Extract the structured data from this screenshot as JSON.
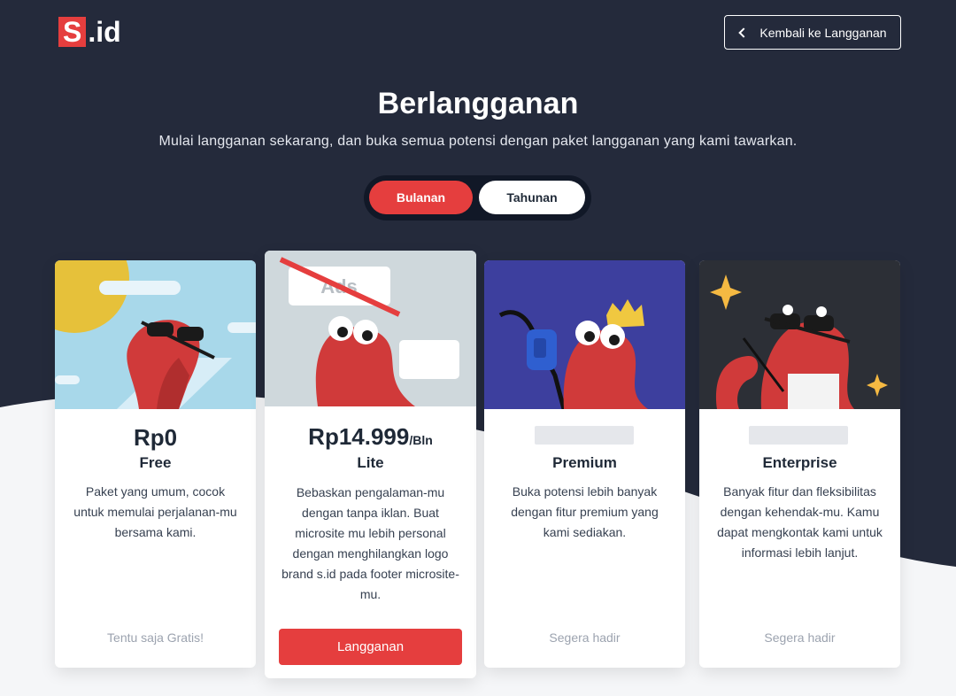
{
  "header": {
    "logo_mark": "S",
    "logo_rest": ".id",
    "back_label": "Kembali ke Langganan"
  },
  "hero": {
    "title": "Berlangganan",
    "subtitle": "Mulai langganan sekarang, dan buka semua potensi dengan paket langganan yang kami tawarkan."
  },
  "billing_toggle": {
    "monthly_label": "Bulanan",
    "yearly_label": "Tahunan",
    "selected": "Bulanan"
  },
  "plans": [
    {
      "price": "Rp0",
      "price_period": "",
      "name": "Free",
      "description": "Paket yang umum, cocok untuk memulai perjalanan-mu bersama kami.",
      "footer": "Tentu saja Gratis!"
    },
    {
      "price": "Rp14.999",
      "price_period": "/Bln",
      "name": "Lite",
      "description": "Bebaskan pengalaman-mu dengan tanpa iklan. Buat microsite mu lebih personal dengan menghilangkan logo brand s.id pada footer microsite-mu.",
      "button_label": "Langganan",
      "illustration_text": "Ads"
    },
    {
      "price": "",
      "name": "Premium",
      "description": "Buka potensi lebih banyak dengan fitur premium yang kami sediakan.",
      "footer": "Segera hadir"
    },
    {
      "price": "",
      "name": "Enterprise",
      "description": "Banyak fitur dan fleksibilitas dengan kehendak-mu. Kamu dapat mengkontak kami untuk informasi lebih lanjut.",
      "footer": "Segera hadir"
    }
  ],
  "colors": {
    "header_bg": "#242a3b",
    "accent": "#e53e3e",
    "page_bg": "#f5f6f8"
  }
}
